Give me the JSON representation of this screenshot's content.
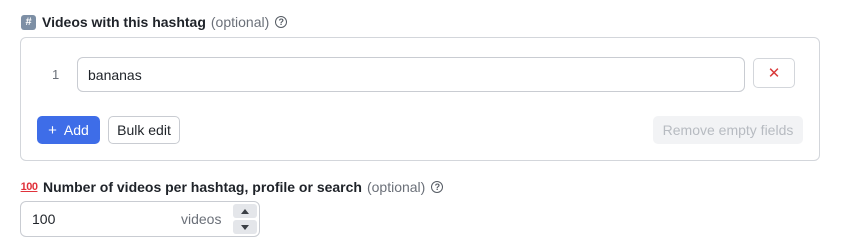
{
  "hashtag_field": {
    "emoji": "#",
    "label": "Videos with this hashtag",
    "optional": "(optional)",
    "help_icon": "?",
    "rows": [
      {
        "index": "1",
        "value": "bananas",
        "remove_icon": "✕"
      }
    ],
    "add_icon": "+",
    "add_label": "Add",
    "bulk_edit_label": "Bulk edit",
    "remove_empty_label": "Remove empty fields"
  },
  "count_field": {
    "emoji": "100",
    "label": "Number of videos per hashtag, profile or search",
    "optional": "(optional)",
    "help_icon": "?",
    "value": "100",
    "unit": "videos"
  },
  "colors": {
    "accent": "#3e6de8",
    "danger": "#d93a3a",
    "border": "#d3d6db",
    "muted_text": "#6b7079"
  }
}
